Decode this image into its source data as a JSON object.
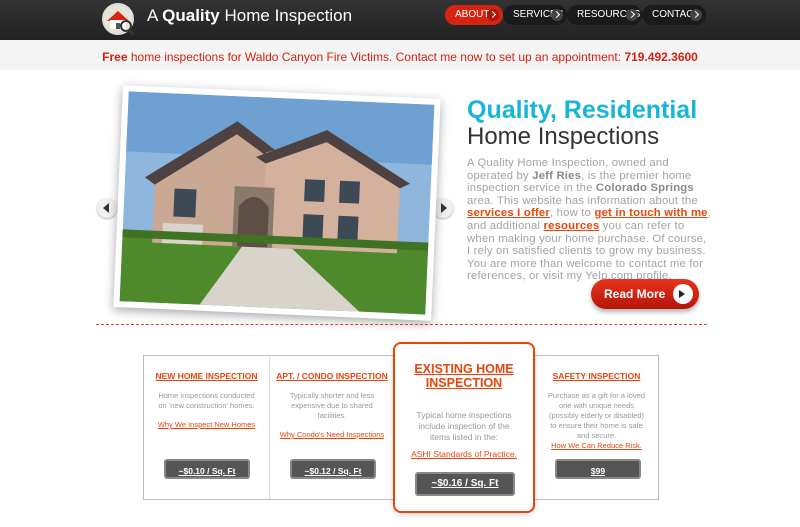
{
  "header": {
    "logo_prefix": "A",
    "logo_bold": "Quality",
    "logo_suffix": "Home Inspection",
    "nav": [
      {
        "label": "ABOUT",
        "active": true
      },
      {
        "label": "SERVICES",
        "active": false
      },
      {
        "label": "RESOURCES",
        "active": false
      },
      {
        "label": "CONTACT",
        "active": false
      }
    ]
  },
  "promo": {
    "bold": "Free",
    "text": "home inspections for Waldo Canyon Fire Victims. Contact me now to set up an appointment:",
    "phone": "719.492.3600"
  },
  "hero": {
    "title_line1": "Quality, Residential",
    "title_line2": "Home Inspections",
    "intro_1": "A Quality Home Inspection, owned and operated by",
    "owner": "Jeff Ries",
    "intro_2": ", is the premier home inspection service in the",
    "city": "Colorado Springs",
    "intro_3": "area. This website has information about the",
    "link_services": "services I offer",
    "intro_4": ", how to",
    "link_contact": "get in touch with me",
    "intro_5": ", and additional",
    "link_resources": "resources",
    "intro_6": "you can refer to when making your home purchase. Of course, I rely on satisfied clients to grow my business. You are more than welcome to contact me for references, or visit my Yelp.com profile.",
    "read_more": "Read More"
  },
  "cards": [
    {
      "title": "NEW HOME INSPECTION",
      "desc": "Home inspections conducted on 'new construction' homes.",
      "link": "Why We Inspect New Homes",
      "price": "~$0.10 / Sq. Ft"
    },
    {
      "title": "APT. / CONDO INSPECTION",
      "desc": "Typically shorter and less expensive due to shared facilities.",
      "link": "Why Condo's Need Inspections",
      "price": "~$0.12 / Sq. Ft"
    },
    {
      "title": "SAFETY INSPECTION",
      "desc": "Purchase as a gift for a loved one with unique needs (possibly elderly or disabled) to ensure their home is safe and secure.",
      "link": "How We Can Reduce Risk.",
      "price": "$99"
    }
  ],
  "featured": {
    "title": "EXISTING HOME INSPECTION",
    "desc": "Typical home inspections include inspection of the items listed in the:",
    "link": "ASHI Standards of Practice.",
    "price": "~$0.16 / Sq. Ft"
  },
  "colors": {
    "accent": "#e8450b",
    "nav_active": "#d62410",
    "heading_blue": "#17b6d7"
  }
}
